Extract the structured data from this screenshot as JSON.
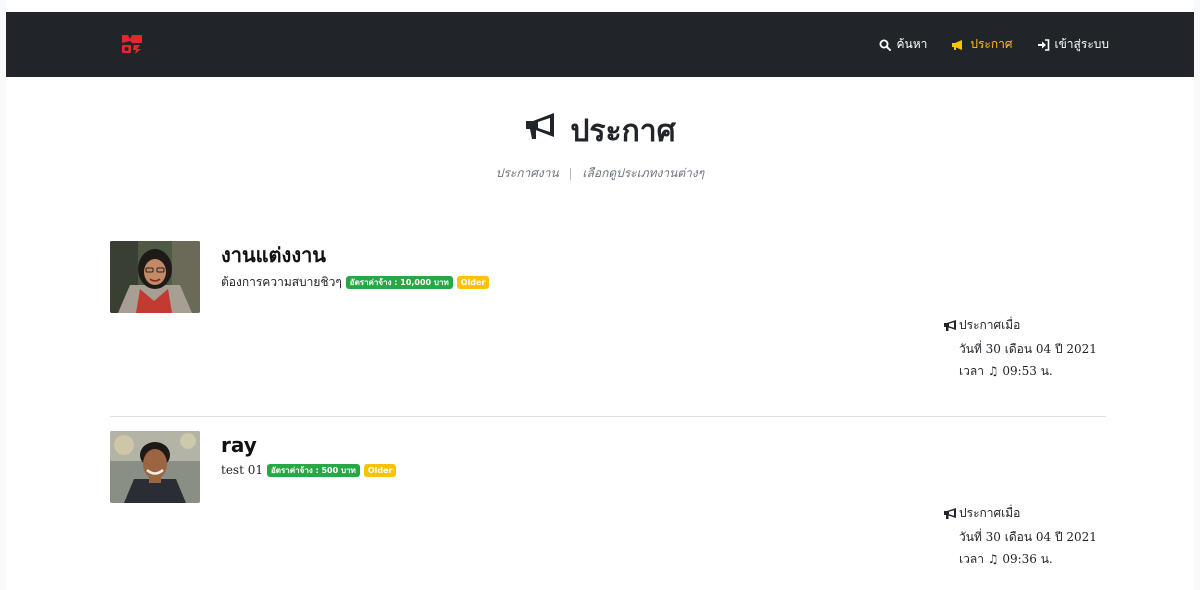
{
  "colors": {
    "navbar": "#212529",
    "accent": "#ffc107",
    "brand": "#e3272d",
    "success": "#28a745"
  },
  "nav": {
    "links": [
      {
        "label": "ค้นหา",
        "icon": "search-icon"
      },
      {
        "label": "ประกาศ",
        "icon": "megaphone-icon",
        "active": true
      },
      {
        "label": "เข้าสู่ระบบ",
        "icon": "sign-in-icon"
      }
    ]
  },
  "header": {
    "title": "ประกาศ",
    "subtitle_left": "ประกาศงาน",
    "separator": "|",
    "subtitle_right": "เลือกดูประเภทงานต่างๆ"
  },
  "posts": [
    {
      "title": "งานแต่งงาน",
      "description": "ต้องการความสบายชิวๆ",
      "wage_badge": "อัตราค่าจ้าง : 10,000 บาท",
      "status_badge": "Older",
      "posted_label": "ประกาศเมื่อ",
      "date": "วันที่ 30 เดือน 04 ปี 2021",
      "time": "เวลา ♫ 09:53 น."
    },
    {
      "title": "ray",
      "description": "test 01",
      "wage_badge": "อัตราค่าจ้าง : 500 บาท",
      "status_badge": "Older",
      "posted_label": "ประกาศเมื่อ",
      "date": "วันที่ 30 เดือน 04 ปี 2021",
      "time": "เวลา ♫ 09:36 น."
    }
  ]
}
